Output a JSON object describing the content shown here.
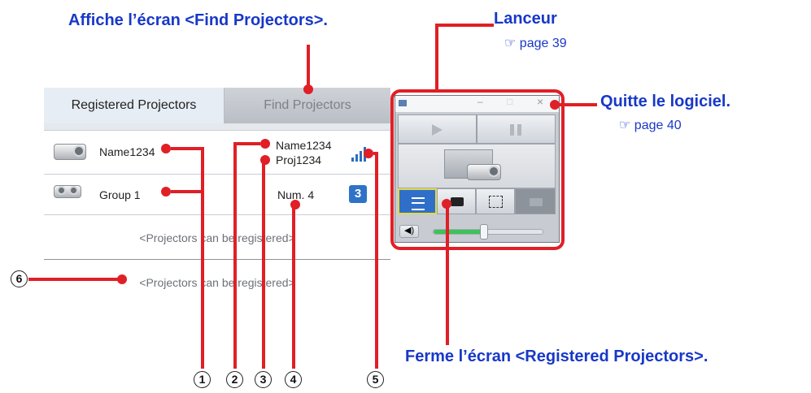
{
  "callouts": {
    "find_screen": "Affiche l’écran <Find Projectors>.",
    "launcher": "Lanceur",
    "launcher_page": "page 39",
    "quit": "Quitte le logiciel.",
    "quit_page": "page 40",
    "close_registered": "Ferme l’écran <Registered Projectors>.",
    "pointer_glyph": "☞"
  },
  "registered": {
    "tabs": [
      {
        "label": "Registered Projectors",
        "active": true
      },
      {
        "label": "Find Projectors",
        "active": false
      }
    ],
    "rows": [
      {
        "name": "Name1234",
        "detail_line1": "Name1234",
        "detail_line2": "Proj1234",
        "signal": "signal-bars-icon"
      },
      {
        "name": "Group 1",
        "detail_line1": "Num. 4",
        "badge": "3"
      },
      {
        "placeholder": "<Projectors can be registered>"
      },
      {
        "placeholder": "<Projectors can be registered>"
      }
    ]
  },
  "launcher": {
    "titlebar": {
      "minimize": "–",
      "restore": "□",
      "close": "×"
    },
    "icons": [
      "play-icon",
      "pause-icon",
      "projector-icon",
      "list-icon",
      "toolbox-icon",
      "area-select-icon",
      "multi-screen-icon",
      "volume-icon"
    ],
    "volume_level": 0.44
  },
  "markers": [
    "1",
    "2",
    "3",
    "4",
    "5",
    "6"
  ],
  "colors": {
    "accent_blue": "#1838c8",
    "annotation_red": "#e01f26",
    "signal_blue": "#2a6ebd",
    "badge_blue": "#2f72c7"
  }
}
